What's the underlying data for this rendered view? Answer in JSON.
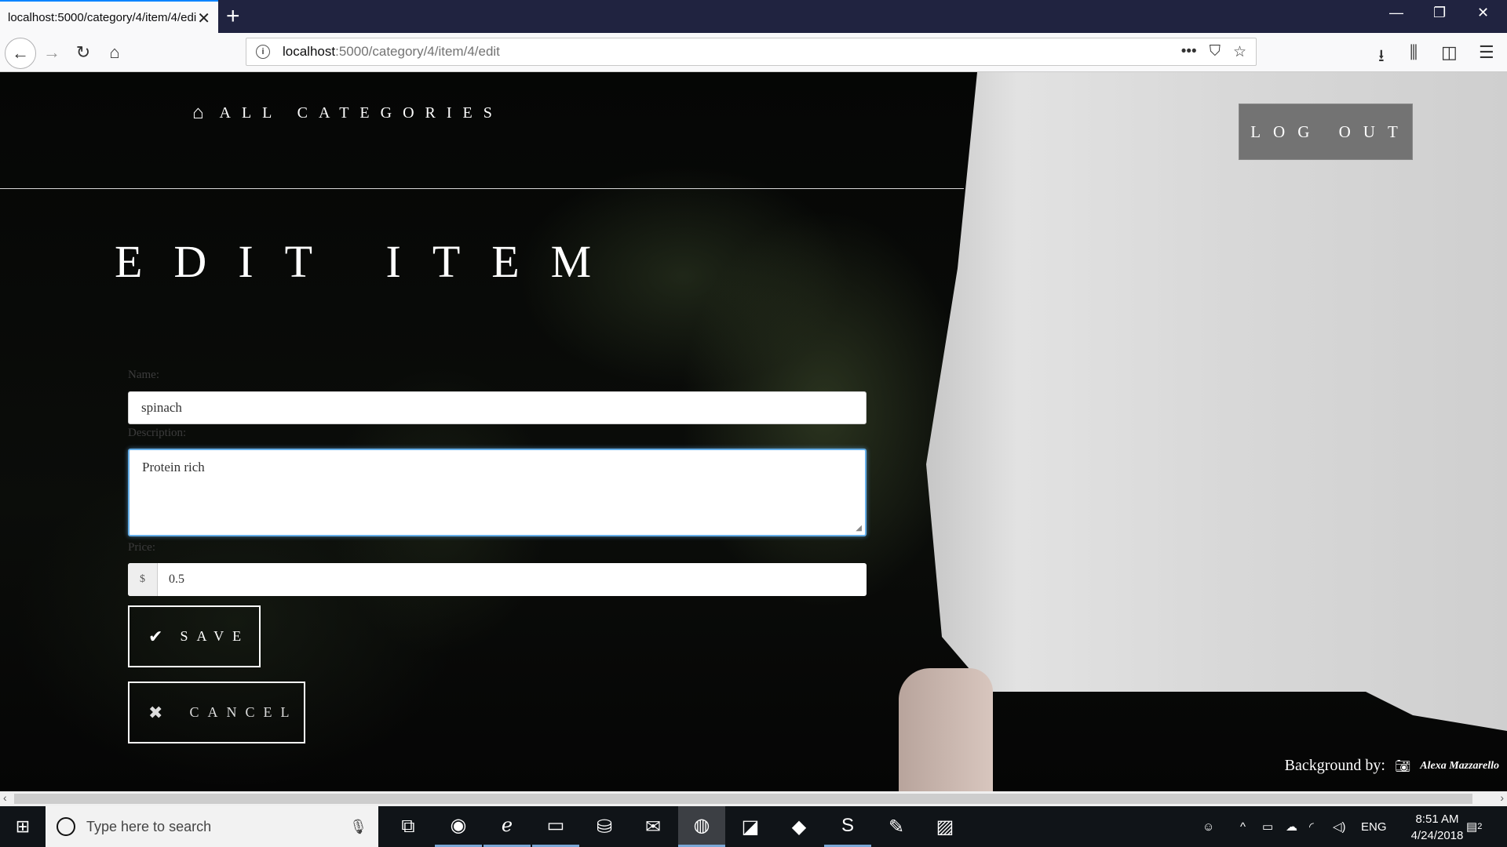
{
  "browser": {
    "tab_title": "localhost:5000/category/4/item/4/edit",
    "url_host": "localhost",
    "url_rest": ":5000/category/4/item/4/edit"
  },
  "nav": {
    "all_categories": "ALL CATEGORIES",
    "logout": "LOG OUT"
  },
  "page": {
    "heading": "EDIT ITEM"
  },
  "form": {
    "name_label": "Name:",
    "name_value": "spinach",
    "description_label": "Description:",
    "description_value": "Protein rich",
    "price_label": "Price:",
    "currency": "$",
    "price_value": "0.5",
    "save_label": "SAVE",
    "cancel_label": "CANCEL"
  },
  "footer": {
    "credit_text": "Background by:",
    "credit_signature": "Alexa Mazzarello"
  },
  "taskbar": {
    "search_placeholder": "Type here to search",
    "language": "ENG",
    "time": "8:51 AM",
    "date": "4/24/2018",
    "notification_count": "2"
  },
  "icons": {
    "home": "home-icon",
    "check": "check-icon",
    "close": "close-icon",
    "camera": "camera-icon"
  }
}
